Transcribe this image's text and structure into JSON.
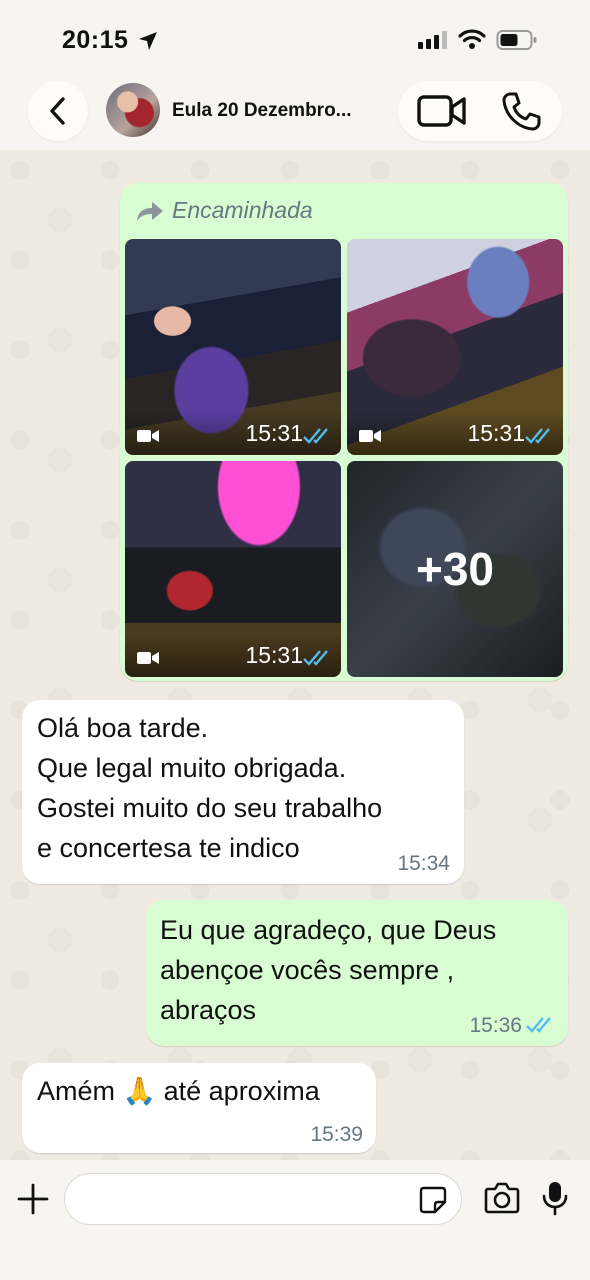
{
  "status_bar": {
    "time": "20:15"
  },
  "header": {
    "contact_name": "Eula 20 Dezembro..."
  },
  "messages": [
    {
      "type": "forwarded-media",
      "direction": "outgoing",
      "forwarded_label": "Encaminhada",
      "media": [
        {
          "kind": "video",
          "time": "15:31"
        },
        {
          "kind": "video",
          "time": "15:31"
        },
        {
          "kind": "video",
          "time": "15:31"
        },
        {
          "kind": "more",
          "more_count": "+30"
        }
      ]
    },
    {
      "type": "text",
      "direction": "incoming",
      "lines": [
        "Olá boa tarde.",
        "Que legal muito obrigada.",
        "Gostei muito do seu trabalho",
        "e concertesa te indico"
      ],
      "time": "15:34"
    },
    {
      "type": "text",
      "direction": "outgoing",
      "lines": [
        "Eu que agradeço, que Deus",
        "abençoe vocês sempre ,",
        "abraços"
      ],
      "time": "15:36"
    },
    {
      "type": "text",
      "direction": "incoming",
      "lines": [
        "Amém 🙏 até aproxima"
      ],
      "time": "15:39"
    }
  ],
  "colors": {
    "outgoing_bubble": "#d9fdd3",
    "incoming_bubble": "#ffffff",
    "read_ticks": "#53bdeb",
    "chat_background": "#efeae2"
  },
  "icons": [
    "back-chevron-icon",
    "video-call-icon",
    "phone-call-icon",
    "forward-arrow-icon",
    "video-camera-icon",
    "double-check-icon",
    "plus-icon",
    "sticker-icon",
    "camera-icon",
    "microphone-icon"
  ]
}
